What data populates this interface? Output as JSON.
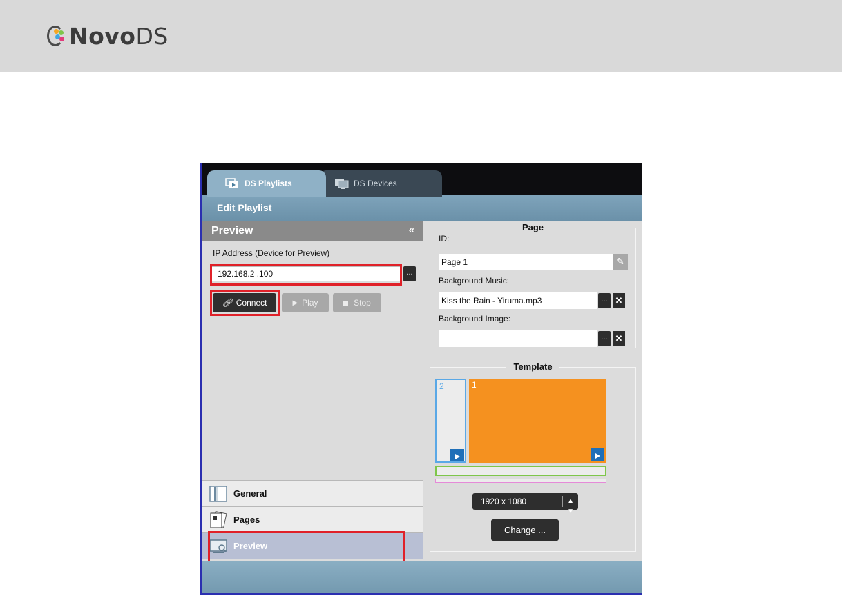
{
  "brand": {
    "name_bold": "Novo",
    "name_light": "DS"
  },
  "tabs": [
    {
      "label": "DS Playlists",
      "active": true
    },
    {
      "label": "DS Devices",
      "active": false
    }
  ],
  "toolbar": {
    "title": "Edit Playlist"
  },
  "preview_panel": {
    "title": "Preview",
    "collapse_glyph": "«",
    "ip_label": "IP Address (Device for Preview)",
    "ip_value": "192.168.2  .100",
    "browse_label": "...",
    "buttons": {
      "connect": "Connect",
      "play": "Play",
      "stop": "Stop"
    },
    "splitter_grip": "........."
  },
  "nav": [
    {
      "label": "General",
      "icon": "general-icon"
    },
    {
      "label": "Pages",
      "icon": "pages-icon"
    },
    {
      "label": "Preview",
      "icon": "preview-icon",
      "selected": true
    }
  ],
  "page_group": {
    "title": "Page",
    "id_label": "ID:",
    "id_value": "Page 1",
    "music_label": "Background Music:",
    "music_value": "Kiss the Rain - Yiruma.mp3",
    "image_label": "Background Image:",
    "image_value": "",
    "browse_label": "...",
    "clear_label": "✕"
  },
  "template_group": {
    "title": "Template",
    "zones": [
      {
        "number": "2",
        "color": "#5aa8e6"
      },
      {
        "number": "1",
        "color": "#f5911f"
      }
    ],
    "ticker_color": "#7ec64a",
    "strip_color": "#e58ad8",
    "resolution": "1920 x 1080",
    "change_label": "Change ..."
  },
  "colors": {
    "highlight": "#e02129",
    "accent": "#8fb1c6",
    "selected_nav": "#b8bfd4"
  }
}
